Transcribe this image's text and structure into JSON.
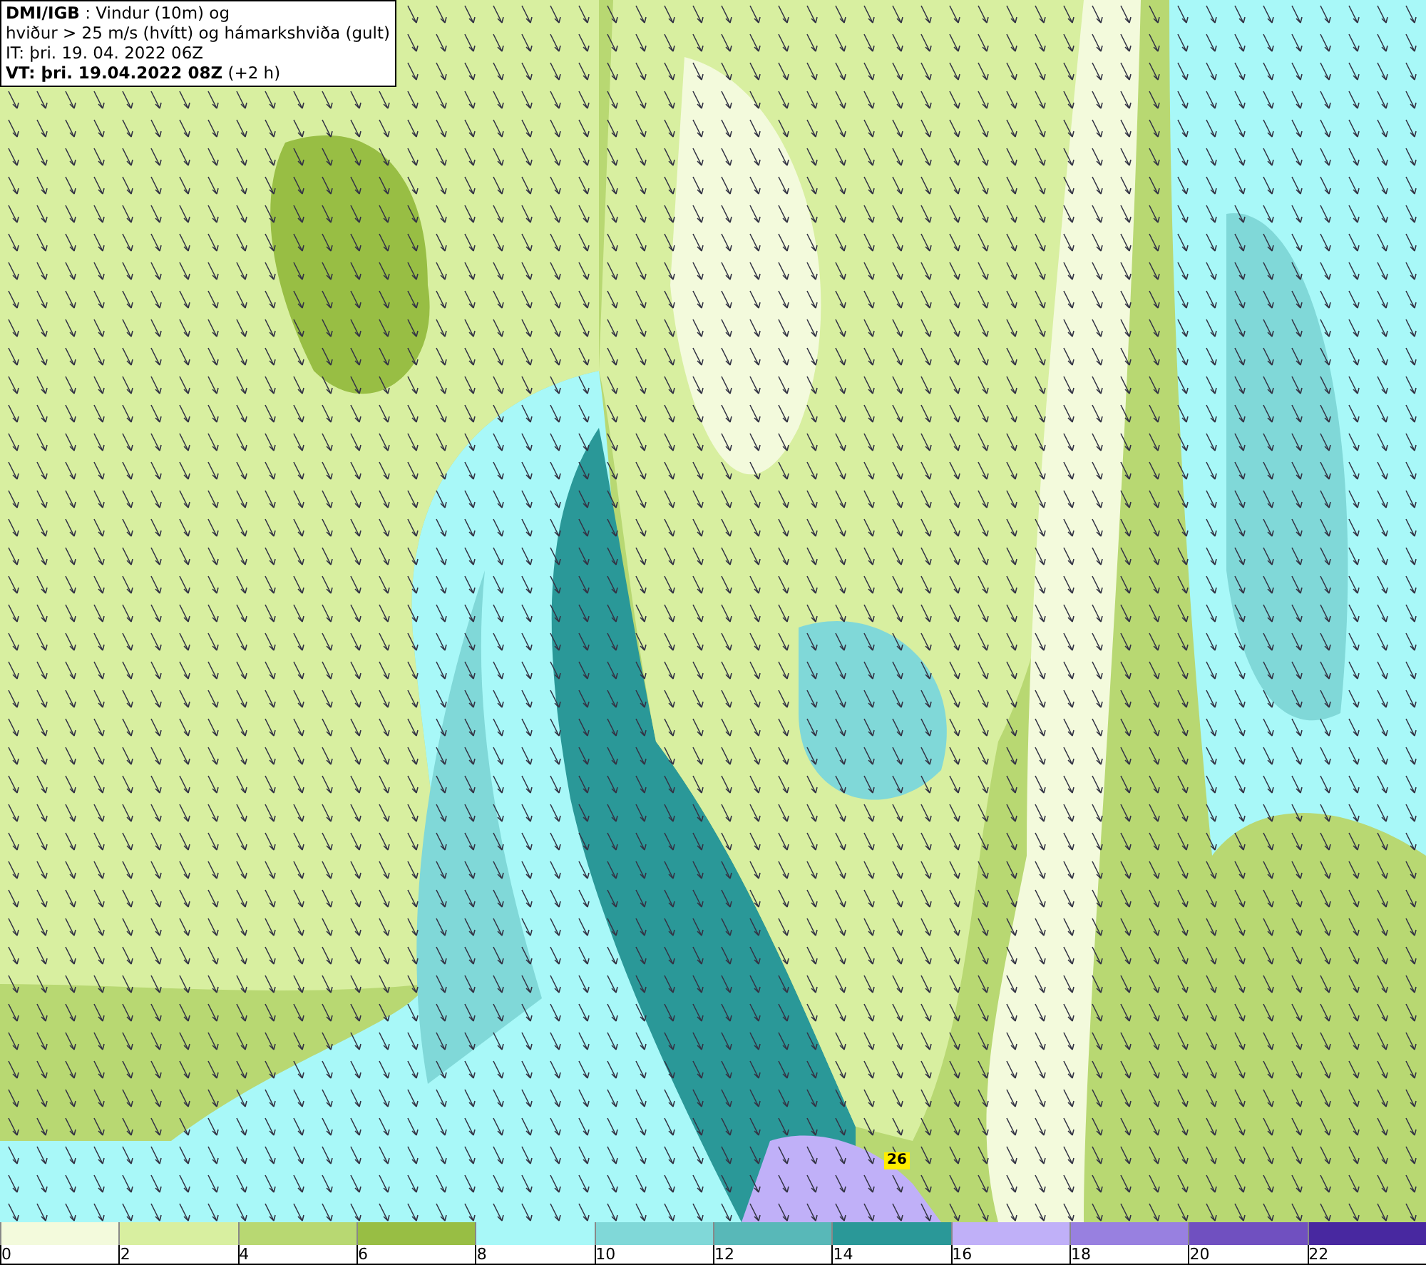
{
  "info_box": {
    "lines": [
      "**DMI/IGB** : Vindur (10m) og",
      "hviður > 25 m/s (hvítt) og hámarkshviða (gult)",
      "IT: þri. 19. 04. 2022 06Z",
      "**VT: þri. 19.04.2022 08Z** (+2 h)"
    ]
  },
  "gust_marker": {
    "label": "26"
  },
  "legend": {
    "bins": [
      {
        "color": "#f3fadc"
      },
      {
        "color": "#d8efa0"
      },
      {
        "color": "#b8d872"
      },
      {
        "color": "#98be44"
      },
      {
        "color": "#a8f8f8"
      },
      {
        "color": "#80d8d8"
      },
      {
        "color": "#58b8b8"
      },
      {
        "color": "#2a9898"
      },
      {
        "color": "#c0b0f8"
      },
      {
        "color": "#9880e0"
      },
      {
        "color": "#7050c0"
      },
      {
        "color": "#4828a0"
      }
    ],
    "ticks": [
      "0",
      "2",
      "4",
      "6",
      "8",
      "10",
      "12",
      "14",
      "16",
      "18",
      "20",
      "22"
    ]
  }
}
